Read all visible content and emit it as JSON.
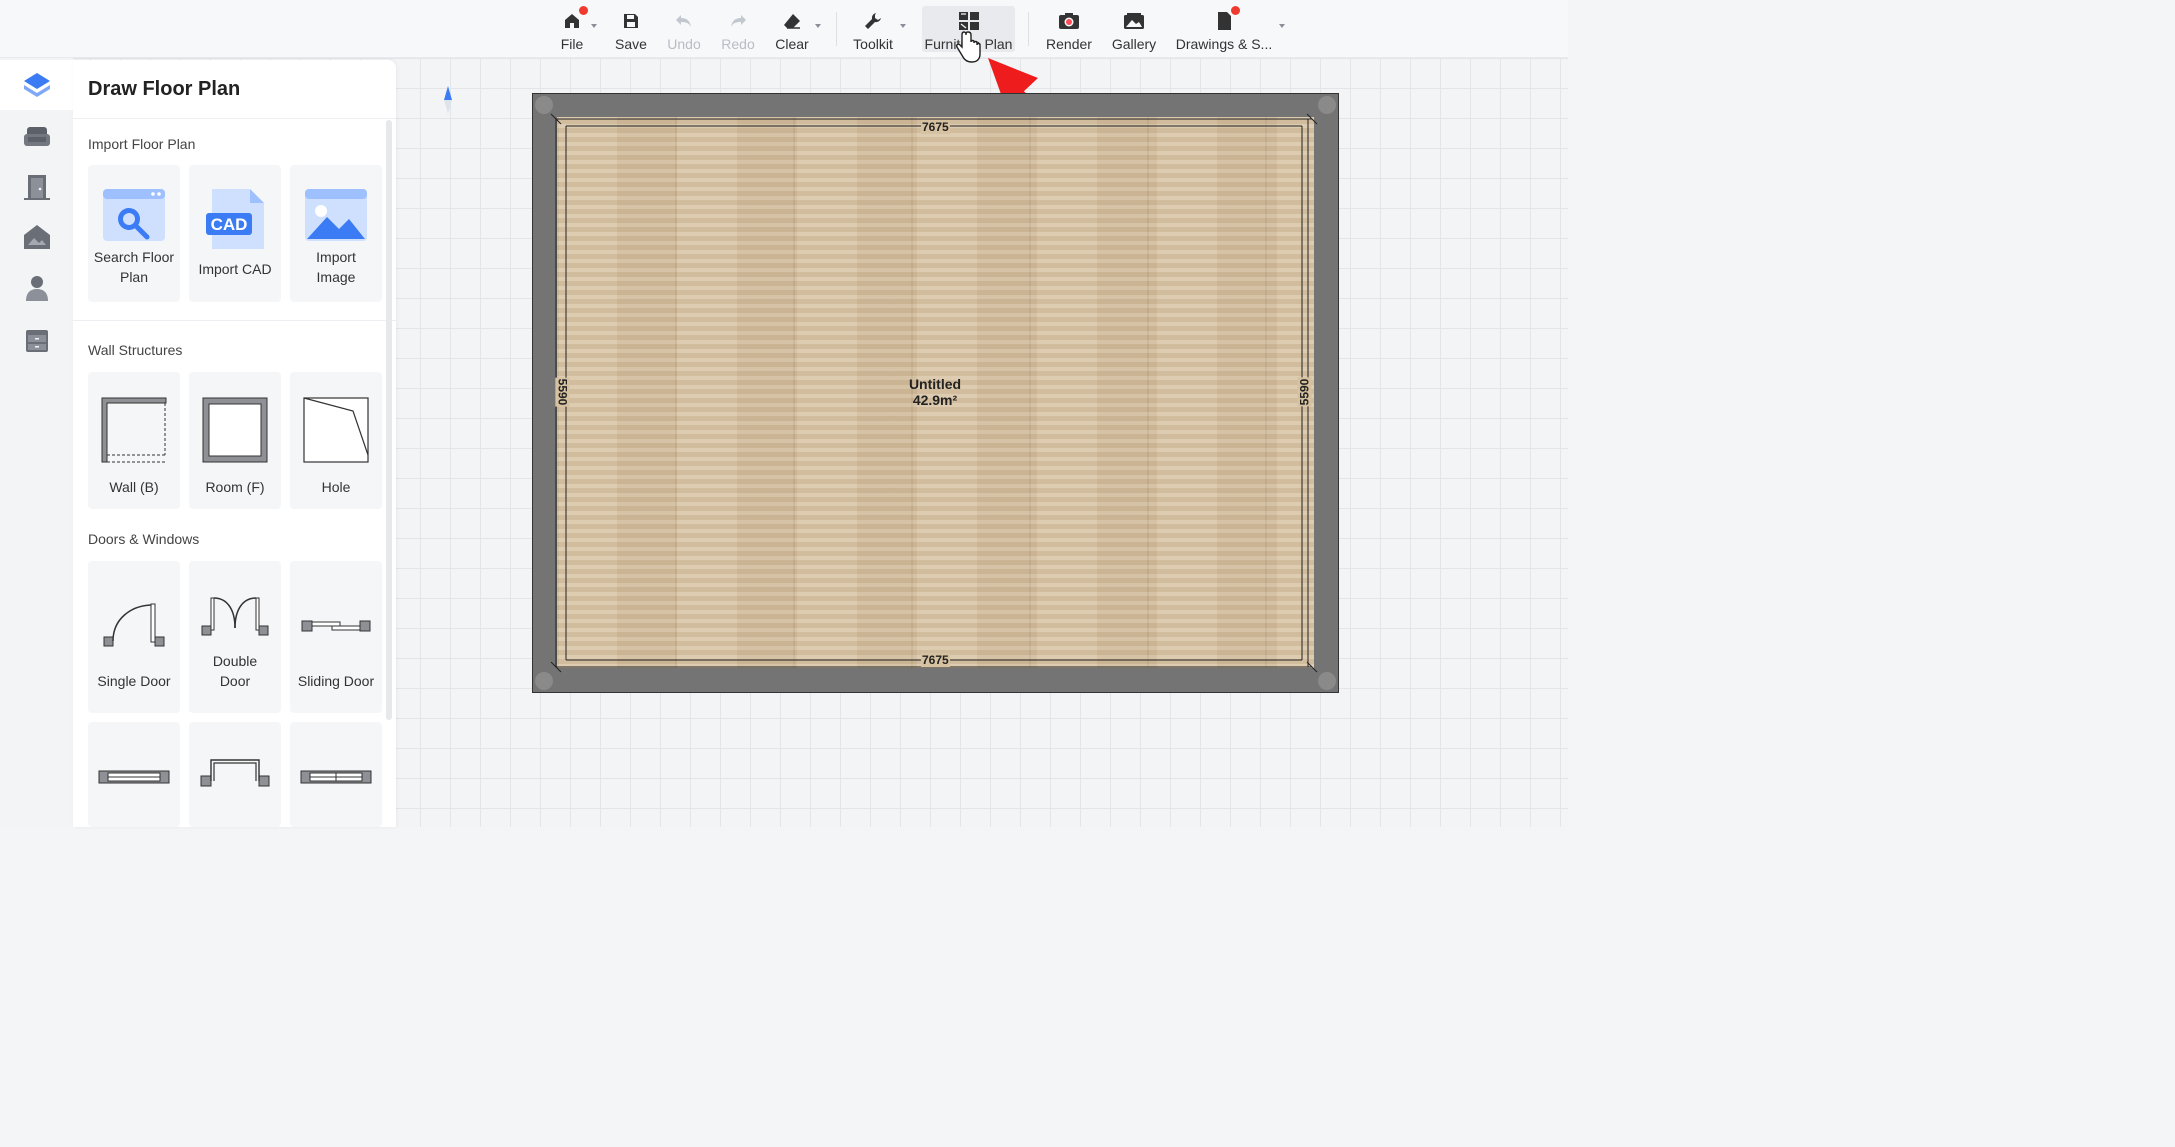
{
  "toolbar": {
    "file": "File",
    "save": "Save",
    "undo": "Undo",
    "redo": "Redo",
    "clear": "Clear",
    "toolkit": "Toolkit",
    "furniture_plan": "Furniture Plan",
    "render": "Render",
    "gallery": "Gallery",
    "drawings": "Drawings & S..."
  },
  "rail": {
    "items": [
      "floor-plan-icon",
      "sofa-icon",
      "door-icon",
      "house-icon",
      "person-icon",
      "cabinet-icon"
    ]
  },
  "panel": {
    "title": "Draw Floor Plan",
    "import_section": "Import Floor Plan",
    "import_tiles": [
      {
        "label": "Search Floor Plan"
      },
      {
        "label": "Import CAD",
        "badge": "CAD"
      },
      {
        "label": "Import Image"
      }
    ],
    "wall_section": "Wall Structures",
    "wall_tiles": [
      {
        "label": "Wall (B)"
      },
      {
        "label": "Room (F)"
      },
      {
        "label": "Hole"
      }
    ],
    "doors_section": "Doors & Windows",
    "door_tiles": [
      {
        "label": "Single Door"
      },
      {
        "label": "Double Door"
      },
      {
        "label": "Sliding Door"
      }
    ]
  },
  "plan": {
    "room_name": "Untitled",
    "room_area": "42.9m²",
    "dim_top": "7675",
    "dim_bottom": "7675",
    "dim_left": "5590",
    "dim_right": "5590"
  },
  "colors": {
    "accent": "#3b7cf5",
    "notification": "#f03a2e",
    "annotation_arrow": "#ee1c1c"
  }
}
